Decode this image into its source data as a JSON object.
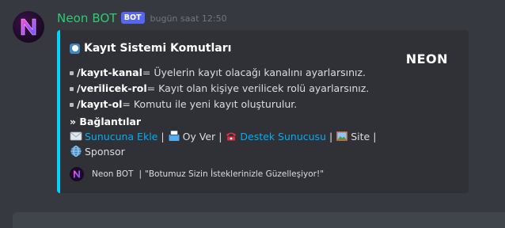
{
  "message": {
    "username": "Neon BOT",
    "bot_tag": "BOT",
    "timestamp": "bugün saat 12:50",
    "avatar_icon": "neon-n-logo",
    "username_color": "#2ecc71",
    "embed_color": "#00d5ff"
  },
  "embed": {
    "title": "Kayıt Sistemi Komutları",
    "thumbnail_text": "NEON",
    "commands": [
      {
        "name": "/kayıt-kanal",
        "description": " = Üyelerin kayıt olacağı kanalını ayarlarsınız."
      },
      {
        "name": "/verilicek-rol",
        "description": " = Kayıt olan kişiye verilicek rolü ayarlarsınız."
      },
      {
        "name": "/kayıt-ol",
        "description": " = Komutu ile yeni kayıt oluşturulur."
      }
    ],
    "links_title": "» Bağlantılar",
    "links": {
      "invite": "Sunucuna Ekle",
      "vote": "Oy Ver",
      "support": "Destek Sunucusu",
      "site": "Site",
      "sponsor": "Sponsor",
      "separator": "|"
    },
    "footer": {
      "name": "Neon BOT",
      "separator": "|",
      "text": "\"Botumuz Sizin İsteklerinizle Güzelleşiyor!\""
    }
  }
}
